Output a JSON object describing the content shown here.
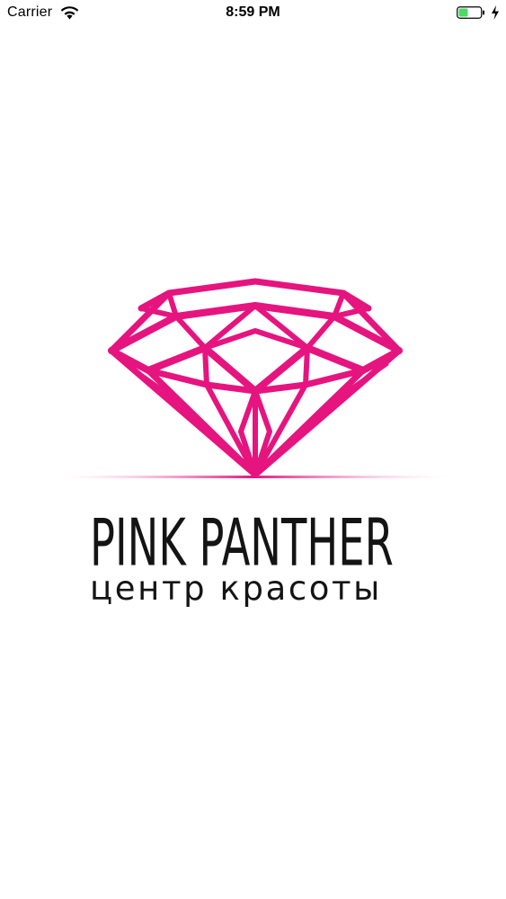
{
  "status_bar": {
    "carrier": "Carrier",
    "time": "8:59 PM",
    "icons": [
      "wifi-icon",
      "battery-icon",
      "charging-icon"
    ],
    "battery_color": "#4cd964"
  },
  "splash": {
    "logo": {
      "icon": "diamond-icon",
      "brand_name": "PINK PANTHER",
      "tagline": "центр красоты",
      "accent_color": "#e6147f"
    }
  }
}
